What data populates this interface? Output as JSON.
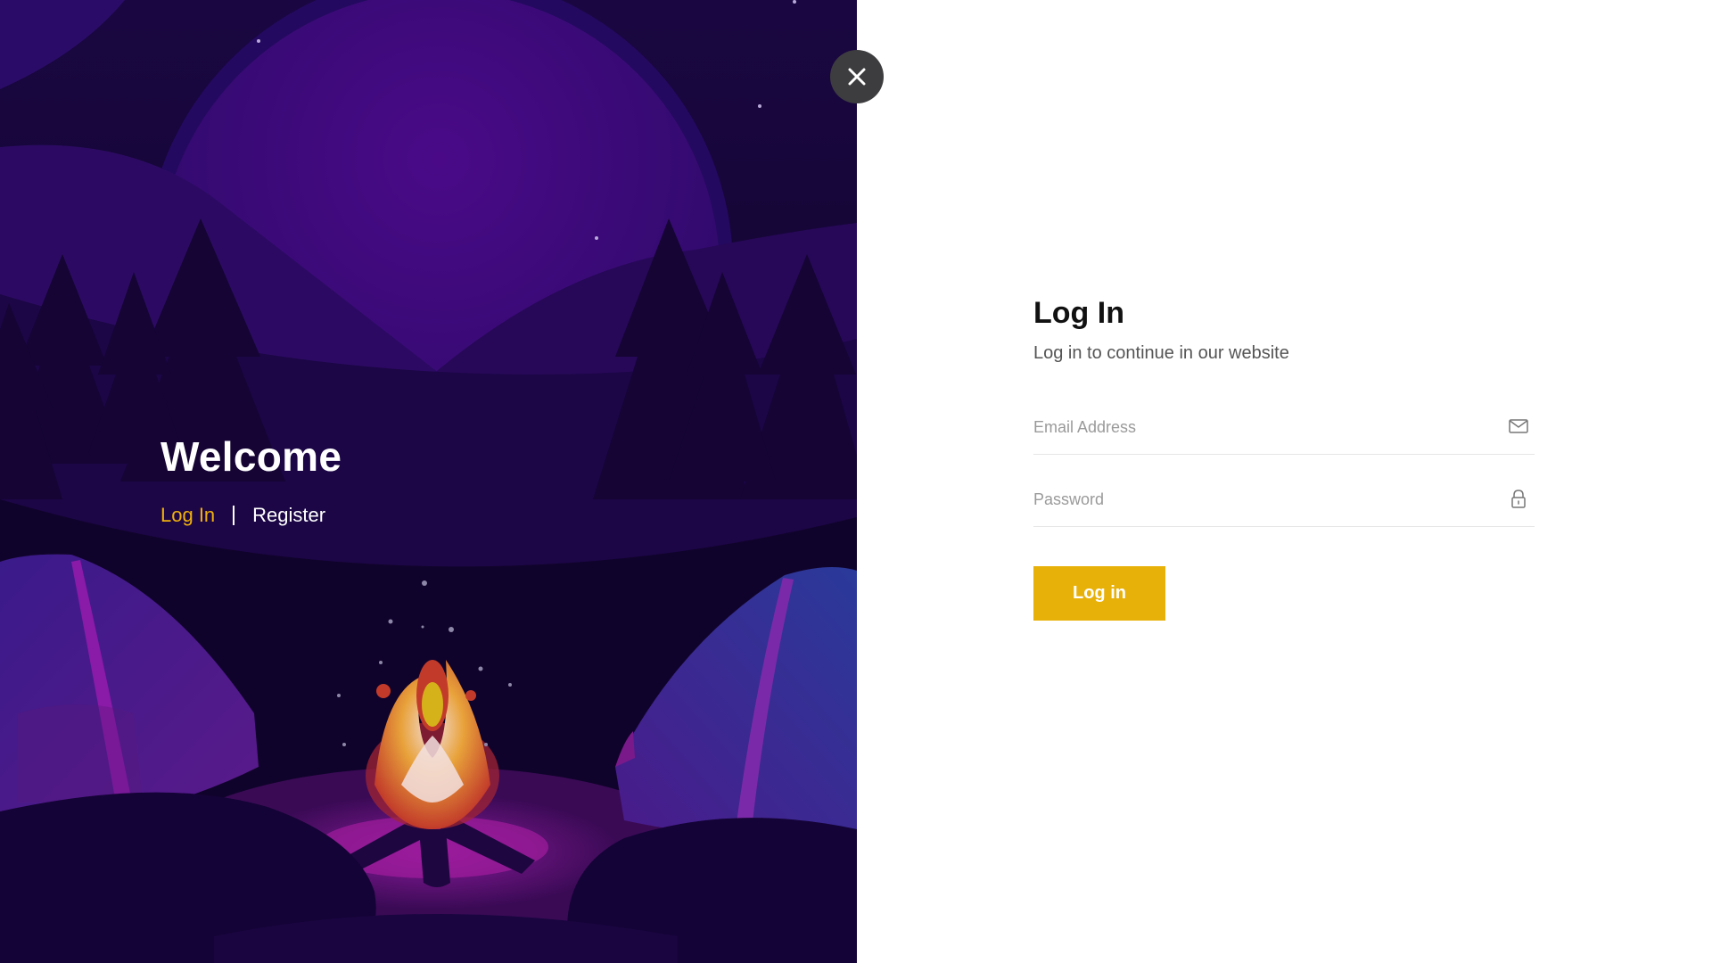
{
  "colors": {
    "accent": "#e8b10a",
    "accent_text": "#f0b10b",
    "panel_dark": "#12052e",
    "close_bg": "#3d3d3f"
  },
  "welcome": {
    "title": "Welcome",
    "nav_login": "Log In",
    "nav_register": "Register"
  },
  "close_button": {
    "icon": "close-icon"
  },
  "login": {
    "title": "Log In",
    "subtitle": "Log in to continue in our website",
    "email": {
      "placeholder": "Email Address",
      "value": "",
      "icon": "envelope-icon"
    },
    "password": {
      "placeholder": "Password",
      "value": "",
      "icon": "lock-icon"
    },
    "submit_label": "Log in"
  }
}
